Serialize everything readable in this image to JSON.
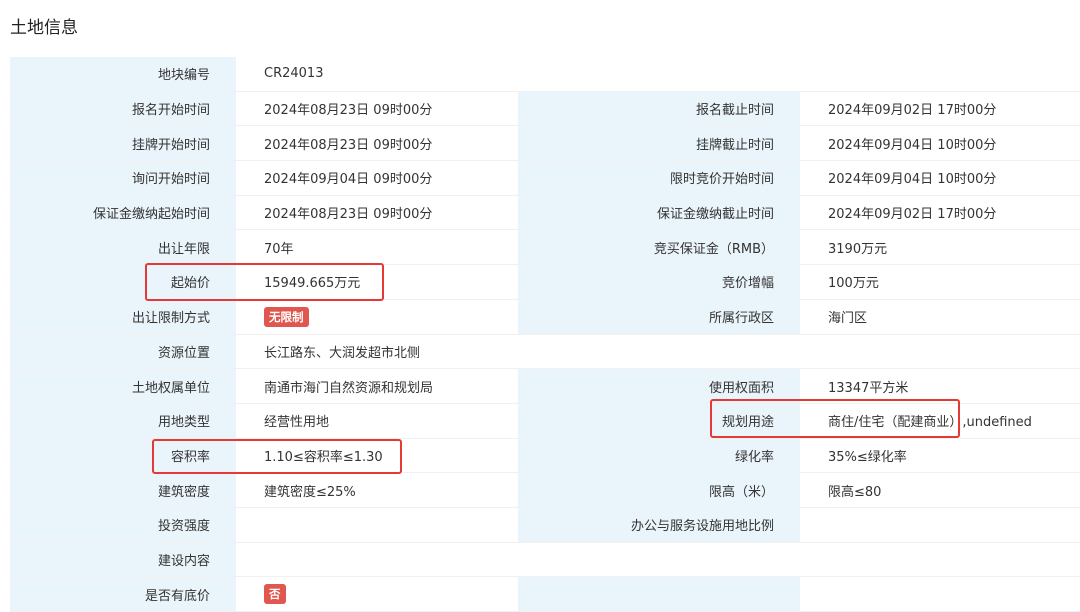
{
  "page": {
    "title": "土地信息"
  },
  "rows": [
    {
      "l1": "地块编号",
      "v1": "CR24013"
    },
    {
      "l1": "报名开始时间",
      "v1": "2024年08月23日 09时00分",
      "l2": "报名截止时间",
      "v2": "2024年09月02日 17时00分"
    },
    {
      "l1": "挂牌开始时间",
      "v1": "2024年08月23日 09时00分",
      "l2": "挂牌截止时间",
      "v2": "2024年09月04日 10时00分"
    },
    {
      "l1": "询问开始时间",
      "v1": "2024年09月04日 09时00分",
      "l2": "限时竞价开始时间",
      "v2": "2024年09月04日 10时00分"
    },
    {
      "l1": "保证金缴纳起始时间",
      "v1": "2024年08月23日 09时00分",
      "l2": "保证金缴纳截止时间",
      "v2": "2024年09月02日 17时00分"
    },
    {
      "l1": "出让年限",
      "v1": "70年",
      "l2": "竞买保证金（RMB）",
      "v2": "3190万元"
    },
    {
      "l1": "起始价",
      "v1": "15949.665万元",
      "l2": "竞价增幅",
      "v2": "100万元"
    },
    {
      "l1": "出让限制方式",
      "v1": "无限制",
      "l2": "所属行政区",
      "v2": "海门区"
    },
    {
      "l1": "资源位置",
      "v1": "长江路东、大润发超市北侧"
    },
    {
      "l1": "土地权属单位",
      "v1": "南通市海门自然资源和规划局",
      "l2": "使用权面积",
      "v2": "13347平方米"
    },
    {
      "l1": "用地类型",
      "v1": "经营性用地",
      "l2": "规划用途",
      "v2": "商住/住宅（配建商业）,undefined"
    },
    {
      "l1": "容积率",
      "v1": "1.10≤容积率≤1.30",
      "l2": "绿化率",
      "v2": "35%≤绿化率"
    },
    {
      "l1": "建筑密度",
      "v1": "建筑密度≤25%",
      "l2": "限高（米）",
      "v2": "限高≤80"
    },
    {
      "l1": "投资强度",
      "v1": "",
      "l2": "办公与服务设施用地比例",
      "v2": ""
    },
    {
      "l1": "建设内容",
      "v1": ""
    },
    {
      "l1": "是否有底价",
      "v1": "否",
      "l2": "",
      "v2": ""
    }
  ],
  "highlight_color": "#e53935",
  "tag_color": "#e0574f",
  "label_bg": "#eaf4fb"
}
